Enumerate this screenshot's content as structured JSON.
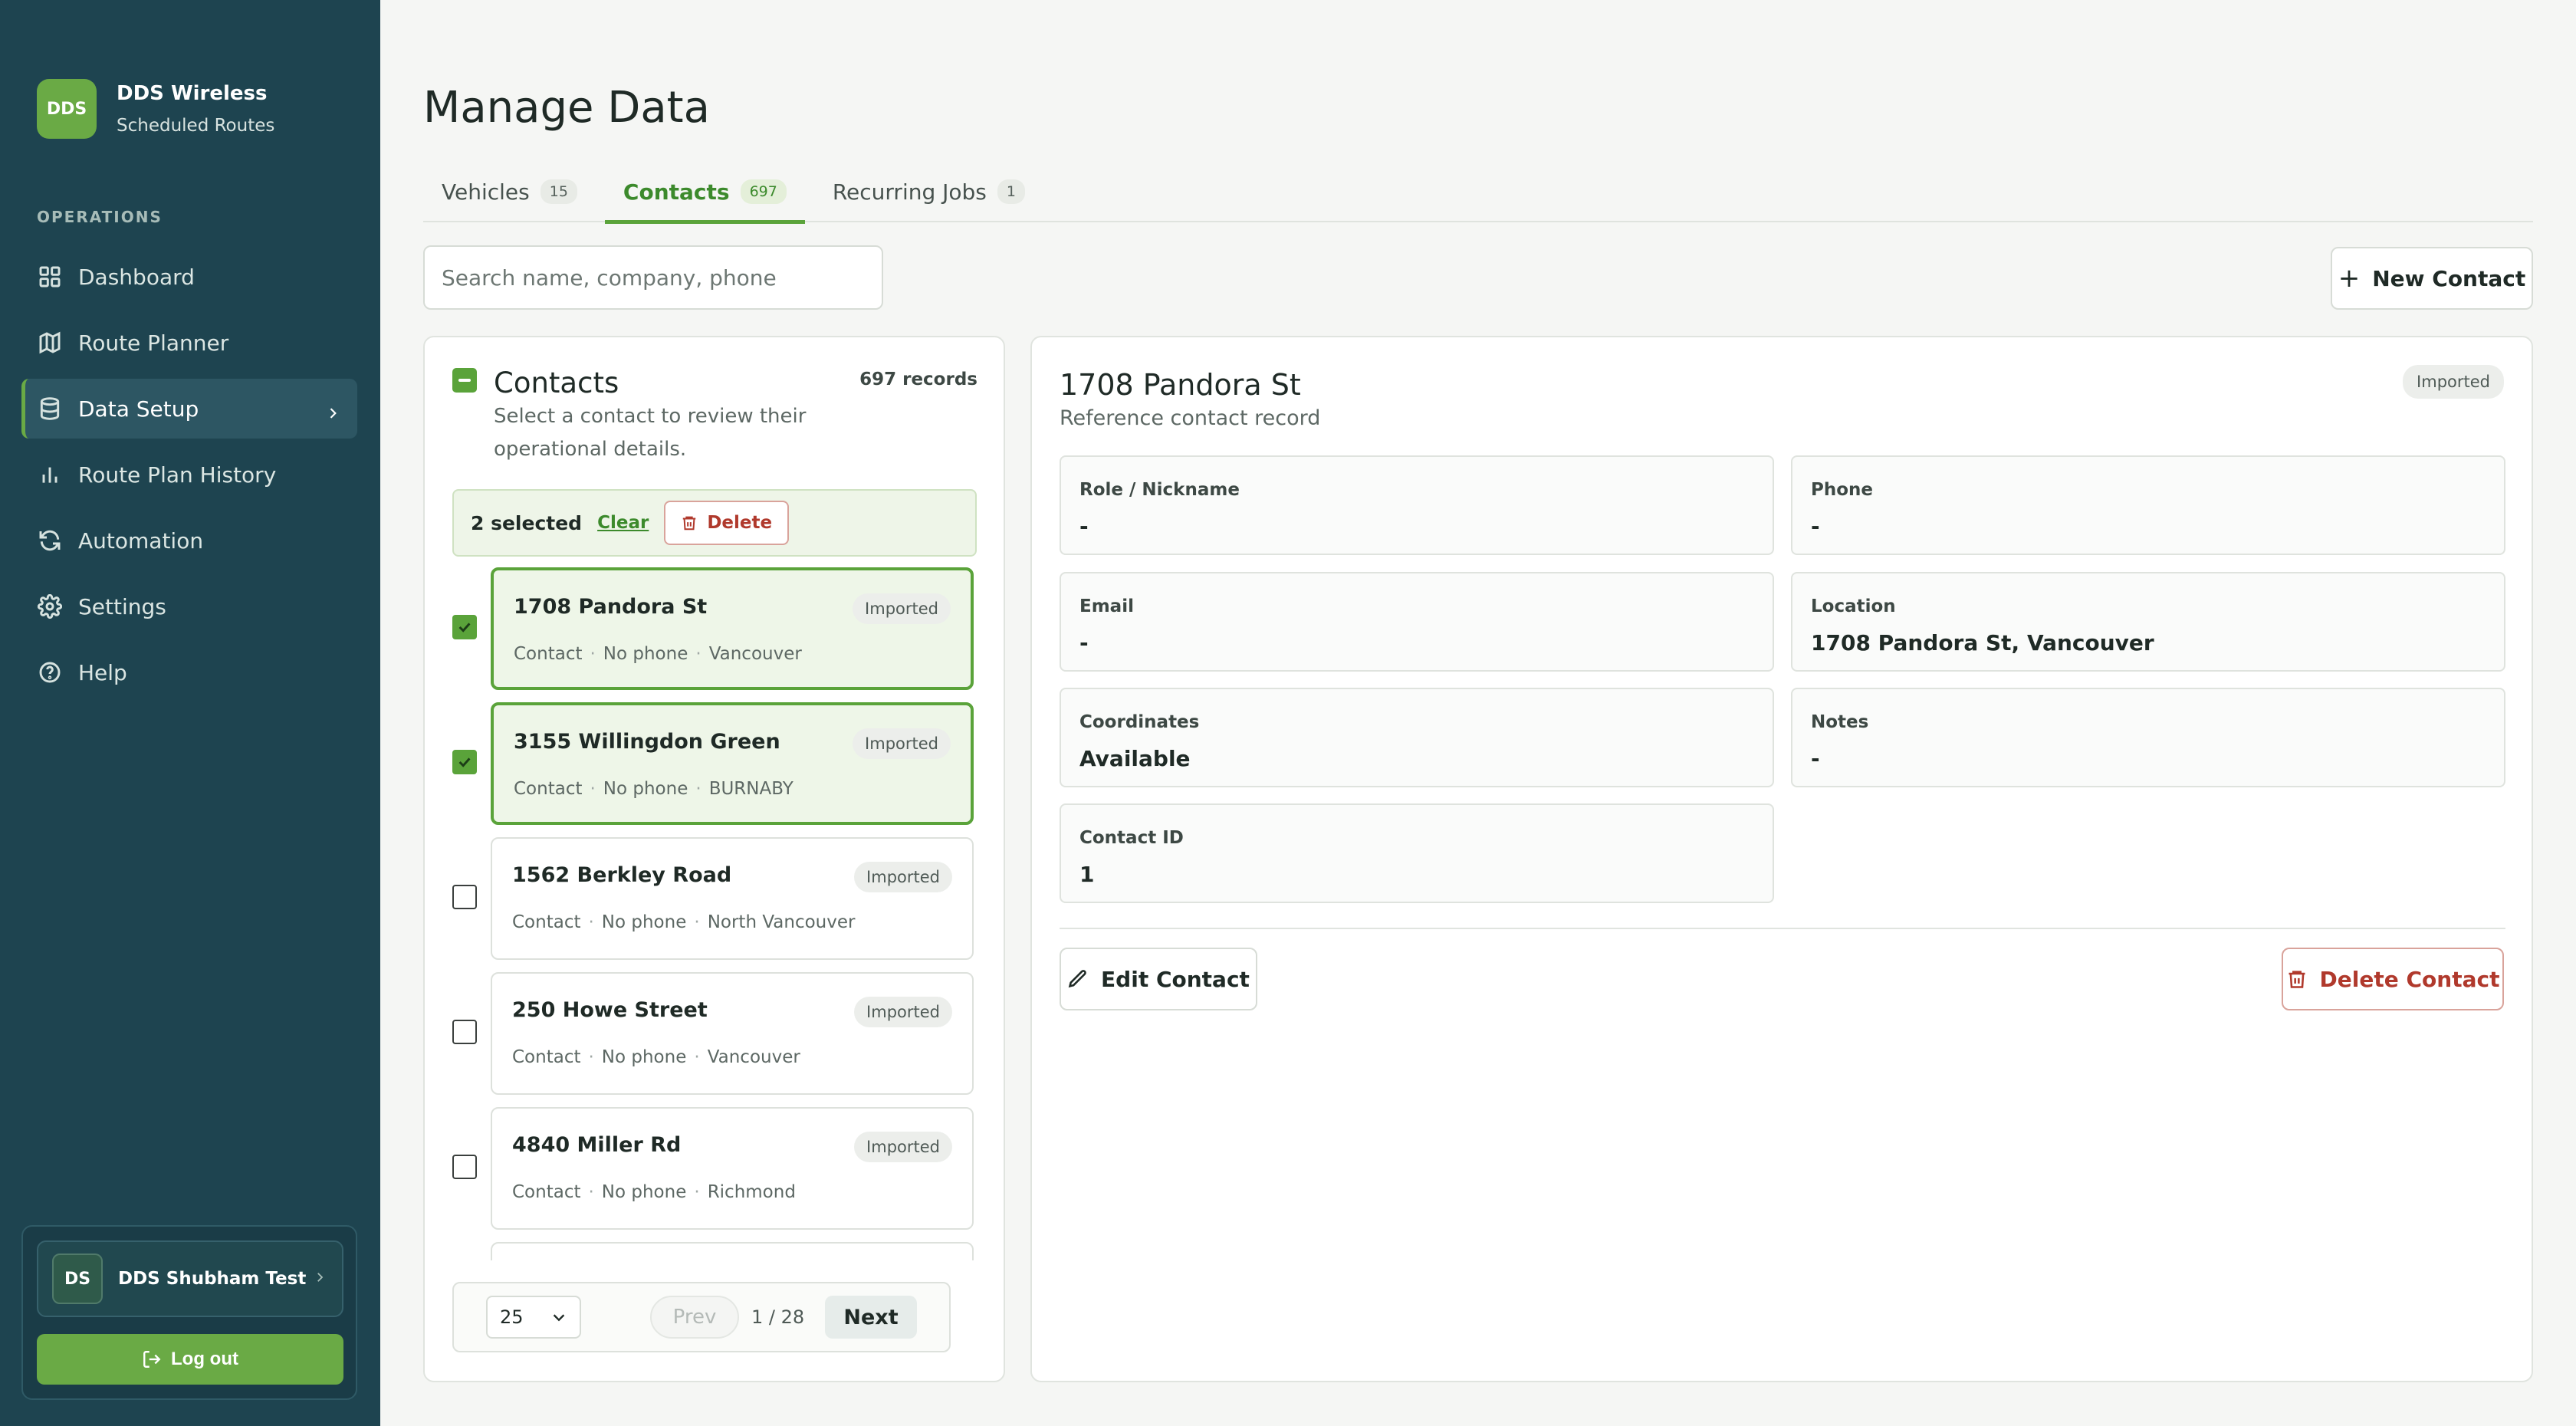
{
  "brand": {
    "logo": "DDS",
    "name": "DDS Wireless",
    "subtitle": "Scheduled Routes"
  },
  "sidebar": {
    "section_label": "OPERATIONS",
    "items": [
      {
        "label": "Dashboard",
        "icon": "grid-icon",
        "active": false
      },
      {
        "label": "Route Planner",
        "icon": "map-icon",
        "active": false
      },
      {
        "label": "Data Setup",
        "icon": "database-icon",
        "active": true
      },
      {
        "label": "Route Plan History",
        "icon": "bar-chart-icon",
        "active": false
      },
      {
        "label": "Automation",
        "icon": "refresh-icon",
        "active": false
      },
      {
        "label": "Settings",
        "icon": "gear-icon",
        "active": false
      },
      {
        "label": "Help",
        "icon": "help-circle-icon",
        "active": false
      }
    ],
    "user": {
      "initials": "DS",
      "name": "DDS Shubham Test"
    },
    "logout_label": "Log out"
  },
  "page": {
    "title": "Manage Data"
  },
  "tabs": [
    {
      "label": "Vehicles",
      "count": "15"
    },
    {
      "label": "Contacts",
      "count": "697",
      "active": true
    },
    {
      "label": "Recurring Jobs",
      "count": "1"
    }
  ],
  "search": {
    "placeholder": "Search name, company, phone",
    "value": ""
  },
  "new_contact_label": "New Contact",
  "list": {
    "title": "Contacts",
    "count": "697 records",
    "subtitle": "Select a contact to review their operational details.",
    "bulk": {
      "selected": "2 selected",
      "clear": "Clear",
      "delete": "Delete"
    },
    "rows": [
      {
        "title": "1708 Pandora St",
        "badge": "Imported",
        "type": "Contact",
        "phone": "No phone",
        "city": "Vancouver",
        "checked": true,
        "selected": true
      },
      {
        "title": "3155 Willingdon Green",
        "badge": "Imported",
        "type": "Contact",
        "phone": "No phone",
        "city": "BURNABY",
        "checked": true,
        "selected": true
      },
      {
        "title": "1562 Berkley Road",
        "badge": "Imported",
        "type": "Contact",
        "phone": "No phone",
        "city": "North Vancouver",
        "checked": false,
        "selected": false
      },
      {
        "title": "250 Howe Street",
        "badge": "Imported",
        "type": "Contact",
        "phone": "No phone",
        "city": "Vancouver",
        "checked": false,
        "selected": false
      },
      {
        "title": "4840 Miller Rd",
        "badge": "Imported",
        "type": "Contact",
        "phone": "No phone",
        "city": "Richmond",
        "checked": false,
        "selected": false
      }
    ],
    "pager": {
      "page_size": "25",
      "prev": "Prev",
      "indicator": "1 / 28",
      "next": "Next"
    }
  },
  "detail": {
    "title": "1708 Pandora St",
    "subtitle": "Reference contact record",
    "badge": "Imported",
    "fields": [
      {
        "label": "Role / Nickname",
        "value": "-"
      },
      {
        "label": "Phone",
        "value": "-"
      },
      {
        "label": "Email",
        "value": "-"
      },
      {
        "label": "Location",
        "value": "1708 Pandora St, Vancouver"
      },
      {
        "label": "Coordinates",
        "value": "Available"
      },
      {
        "label": "Notes",
        "value": "-"
      },
      {
        "label": "Contact ID",
        "value": "1"
      }
    ],
    "edit_label": "Edit Contact",
    "delete_label": "Delete Contact"
  },
  "colors": {
    "sidebar": "#1e4450",
    "accent": "#5aa33a",
    "danger": "#b0392c"
  }
}
